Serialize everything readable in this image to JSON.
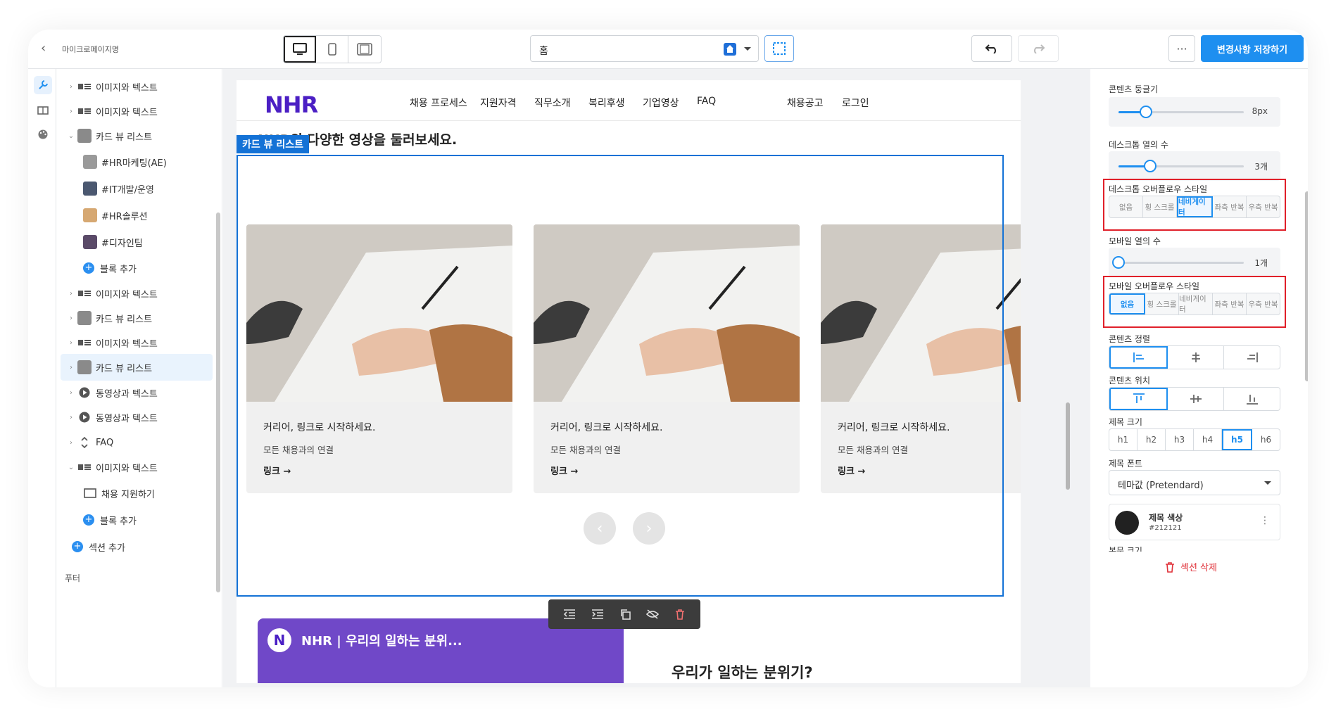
{
  "topbar": {
    "site_title": "마이크로페이지명",
    "page_select_value": "홈",
    "save_label": "변경사항 저장하기",
    "more_label": "···"
  },
  "tree": {
    "items": [
      {
        "label": "이미지와 텍스트"
      },
      {
        "label": "이미지와 텍스트"
      },
      {
        "label": "카드 뷰 리스트"
      },
      {
        "label": "#HR마케팅(AE)"
      },
      {
        "label": "#IT개발/운영"
      },
      {
        "label": "#HR솔루션"
      },
      {
        "label": "#디자인팀"
      },
      {
        "label": "블록 추가"
      },
      {
        "label": "이미지와 텍스트"
      },
      {
        "label": "카드 뷰 리스트"
      },
      {
        "label": "이미지와 텍스트"
      },
      {
        "label": "카드 뷰 리스트"
      },
      {
        "label": "동영상과 텍스트"
      },
      {
        "label": "동영상과 텍스트"
      },
      {
        "label": "FAQ"
      },
      {
        "label": "이미지와 텍스트"
      },
      {
        "label": "채용 지원하기"
      },
      {
        "label": "블록 추가"
      },
      {
        "label": "섹션 추가"
      },
      {
        "label": "푸터"
      }
    ]
  },
  "canvas": {
    "logo": "NHR",
    "nav": [
      "채용 프로세스",
      "지원자격",
      "직무소개",
      "복리후생",
      "기업영상",
      "FAQ",
      "채용공고",
      "로그인"
    ],
    "section_heading": "NHR의 다양한 영상을 둘러보세요.",
    "selection_label": "카드 뷰 리스트",
    "cards": [
      {
        "title": "커리어, 링크로 시작하세요.",
        "desc": "모든 채용과의 연결",
        "link": "링크 →"
      },
      {
        "title": "커리어, 링크로 시작하세요.",
        "desc": "모든 채용과의 연결",
        "link": "링크 →"
      },
      {
        "title": "커리어, 링크로 시작하세요.",
        "desc": "모든 채용과의 연결",
        "link": "링크 →"
      }
    ],
    "video_title": "NHR | 우리의 일하는 분위...",
    "video_badge": "N",
    "bottom_heading": "우리가 일하는 분위기?"
  },
  "panel": {
    "radius": {
      "label": "콘텐츠 둥글기",
      "value": "8px",
      "level": 0.22
    },
    "desktop_cols": {
      "label": "데스크톱 열의 수",
      "value": "3개",
      "level": 0.25
    },
    "desktop_overflow": {
      "label": "데스크톱 오버플로우 스타일",
      "options": [
        "없음",
        "횡 스크롤",
        "네비게이터",
        "좌측 반복",
        "우측 반복"
      ],
      "selected": 2
    },
    "mobile_cols": {
      "label": "모바일 열의 수",
      "value": "1개",
      "level": 0.0
    },
    "mobile_overflow": {
      "label": "모바일 오버플로우 스타일",
      "options": [
        "없음",
        "횡 스크롤",
        "네비게이터",
        "좌측 반복",
        "우측 반복"
      ],
      "selected": 0
    },
    "content_align": {
      "label": "콘텐츠 정렬"
    },
    "content_position": {
      "label": "콘텐츠 위치"
    },
    "title_size": {
      "label": "제목 크기",
      "options": [
        "h1",
        "h2",
        "h3",
        "h4",
        "h5",
        "h6"
      ],
      "selected": 4
    },
    "title_font": {
      "label": "제목 폰트",
      "value": "테마값 (Pretendard)"
    },
    "title_color": {
      "label": "제목 색상",
      "hex": "#212121"
    },
    "body_size_label": "본문 크기",
    "delete_label": "섹션 삭제"
  },
  "colors": {
    "accent": "#1e8ff0",
    "selection": "#1472d6",
    "highlight": "#e0202a",
    "logo": "#4b1fc4"
  }
}
